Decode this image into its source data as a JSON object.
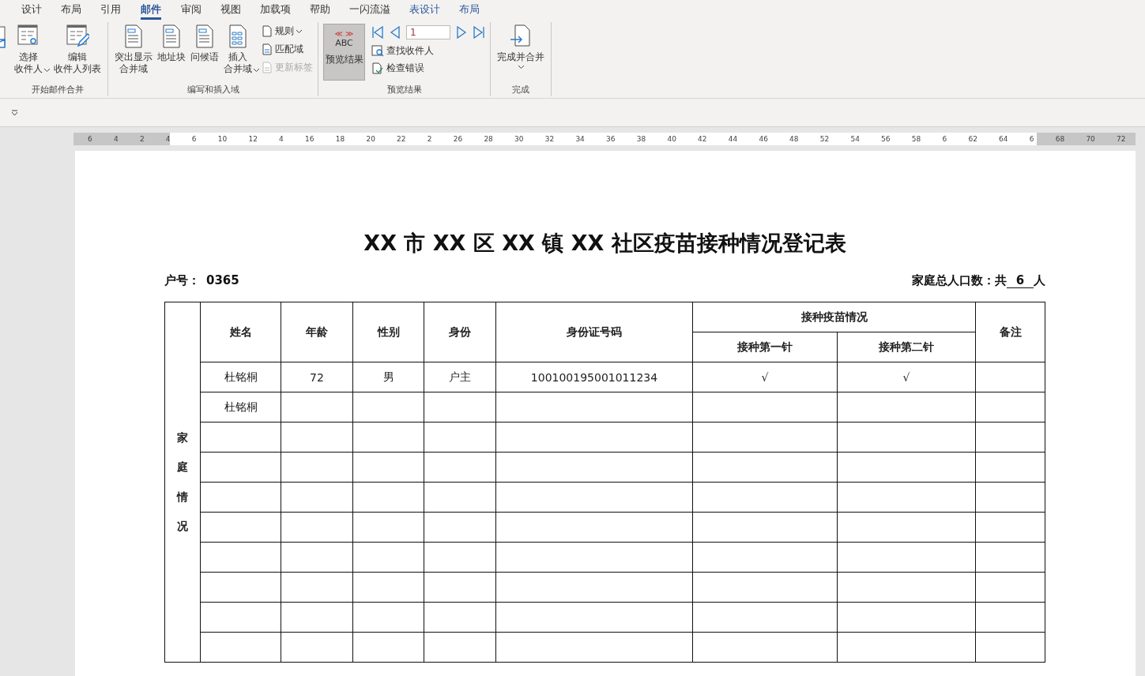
{
  "tabs": [
    {
      "label": "设计",
      "selected": false,
      "contextual": false
    },
    {
      "label": "布局",
      "selected": false,
      "contextual": false
    },
    {
      "label": "引用",
      "selected": false,
      "contextual": false
    },
    {
      "label": "邮件",
      "selected": true,
      "contextual": false
    },
    {
      "label": "审阅",
      "selected": false,
      "contextual": false
    },
    {
      "label": "视图",
      "selected": false,
      "contextual": false
    },
    {
      "label": "加载项",
      "selected": false,
      "contextual": false
    },
    {
      "label": "帮助",
      "selected": false,
      "contextual": false
    },
    {
      "label": "一闪流溢",
      "selected": false,
      "contextual": false
    },
    {
      "label": "表设计",
      "selected": false,
      "contextual": true
    },
    {
      "label": "布局",
      "selected": false,
      "contextual": true
    }
  ],
  "ribbon": {
    "groups": [
      {
        "label": "开始邮件合并",
        "items": [
          {
            "kind": "big",
            "lines": [
              "选择",
              "收件人"
            ],
            "dropdown": true
          },
          {
            "kind": "big",
            "lines": [
              "编辑",
              "收件人列表"
            ],
            "dropdown": false
          }
        ]
      },
      {
        "label": "编写和插入域",
        "items": [
          {
            "kind": "big",
            "lines": [
              "突出显示",
              "合并域"
            ],
            "dropdown": false
          },
          {
            "kind": "big",
            "lines": [
              "地址块"
            ],
            "dropdown": false
          },
          {
            "kind": "big",
            "lines": [
              "问候语"
            ],
            "dropdown": false
          },
          {
            "kind": "big",
            "lines": [
              "插入",
              "合并域"
            ],
            "dropdown": true
          },
          {
            "kind": "stack",
            "entries": [
              {
                "label": "规则",
                "dropdown": true,
                "disabled": false
              },
              {
                "label": "匹配域",
                "dropdown": false,
                "disabled": false
              },
              {
                "label": "更新标签",
                "dropdown": false,
                "disabled": true
              }
            ]
          }
        ]
      },
      {
        "label": "预览结果",
        "items": [
          {
            "kind": "preview",
            "marks": "≪ ≫",
            "abc": "ABC",
            "lines": [
              "预览结果"
            ],
            "selected": true
          },
          {
            "kind": "nav",
            "record": "1",
            "entries": [
              {
                "label": "查找收件人",
                "disabled": false
              },
              {
                "label": "检查错误",
                "disabled": false
              }
            ]
          }
        ]
      },
      {
        "label": "完成",
        "items": [
          {
            "kind": "big",
            "lines": [
              "完成并合并"
            ],
            "dropdown": true
          }
        ]
      }
    ]
  },
  "ruler": {
    "labels": [
      "6",
      "4",
      "2",
      "4",
      "6",
      "10",
      "12",
      "4",
      "16",
      "18",
      "20",
      "22",
      "2",
      "26",
      "28",
      "30",
      "32",
      "34",
      "36",
      "38",
      "40",
      "42",
      "44",
      "46",
      "48",
      "52",
      "54",
      "56",
      "58",
      "6",
      "62",
      "64",
      "6",
      "68",
      "70",
      "72"
    ]
  },
  "document": {
    "title": "XX 市 XX 区 XX 镇 XX 社区疫苗接种情况登记表",
    "household_label": "户号：",
    "household_no": "0365",
    "population_label": "家庭总人口数：共",
    "population": "6",
    "population_unit": "人",
    "table": {
      "side_label": "家庭情况",
      "columns": [
        "姓名",
        "年龄",
        "性别",
        "身份",
        "身份证号码"
      ],
      "group_header": "接种疫苗情况",
      "group_columns": [
        "接种第一针",
        "接种第二针"
      ],
      "last_column": "备注",
      "rows": [
        {
          "name": "杜铭桐",
          "age": "72",
          "sex": "男",
          "role": "户主",
          "id_number": "100100195001011234",
          "dose_1": "√",
          "dose_2": "√"
        },
        {
          "name": "杜铭桐"
        },
        {},
        {},
        {},
        {},
        {},
        {},
        {},
        {}
      ]
    }
  }
}
